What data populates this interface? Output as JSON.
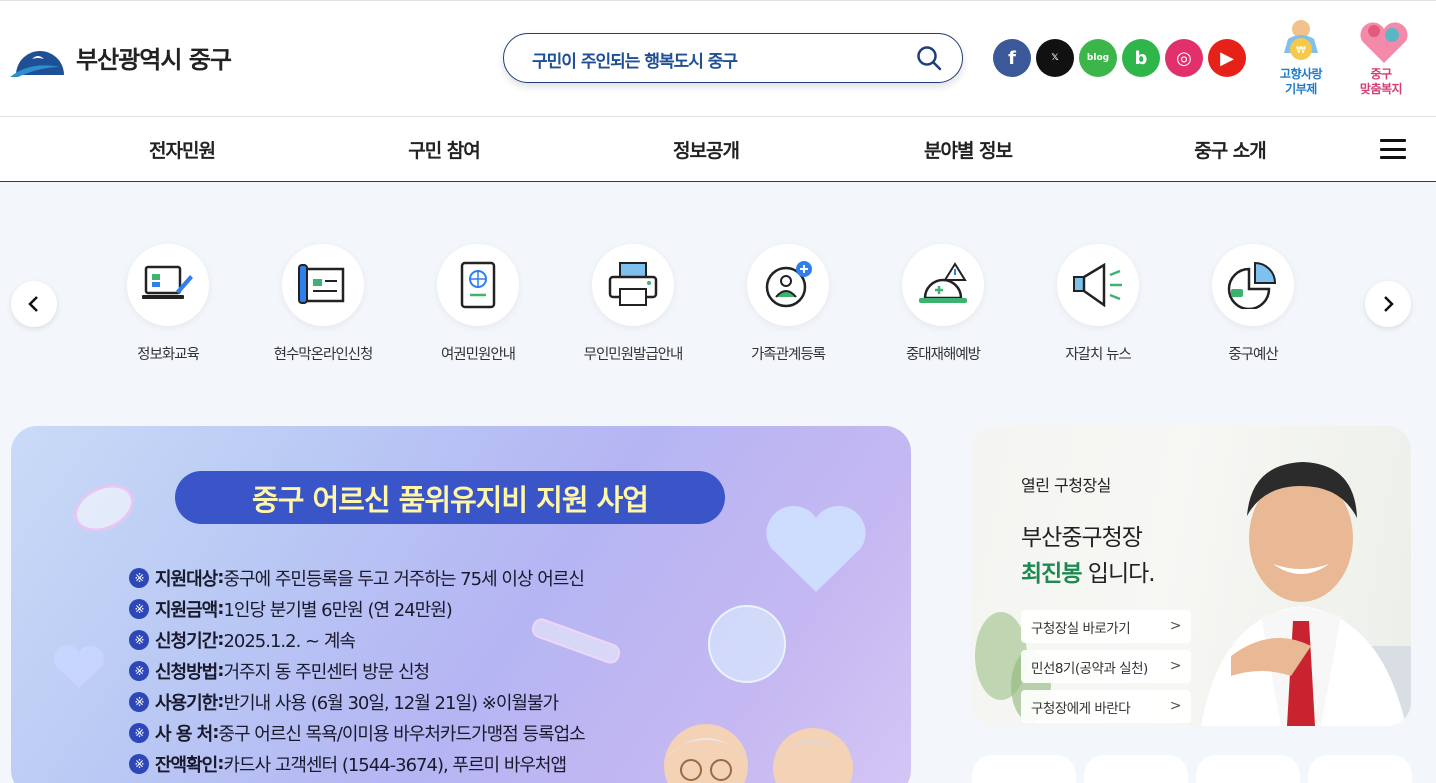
{
  "header": {
    "logo_text": "부산광역시 중구",
    "search_placeholder": "구민이 주인되는 행복도시 중구",
    "sns": [
      {
        "name": "facebook-icon",
        "glyph": "f",
        "color": "#3b5998"
      },
      {
        "name": "x-icon",
        "glyph": "𝕏",
        "color": "#111111"
      },
      {
        "name": "blog-icon",
        "glyph": "blog",
        "color": "#3cb54a"
      },
      {
        "name": "band-icon",
        "glyph": "b",
        "color": "#2fb64b"
      },
      {
        "name": "instagram-icon",
        "glyph": "◎",
        "color": "#e1306c"
      },
      {
        "name": "youtube-icon",
        "glyph": "▶",
        "color": "#e62117"
      }
    ],
    "quick_links": [
      {
        "label_line1": "고향사랑",
        "label_line2": "기부제",
        "color": "#1f7bc7"
      },
      {
        "label_line1": "중구",
        "label_line2": "맞춤복지",
        "color": "#d33b73"
      }
    ]
  },
  "nav": {
    "items": [
      "전자민원",
      "구민 참여",
      "정보공개",
      "분야별 정보",
      "중구 소개"
    ]
  },
  "quick_menu": {
    "items": [
      {
        "label": "정보화교육",
        "icon": "computer-education-icon"
      },
      {
        "label": "현수막온라인신청",
        "icon": "banner-application-icon"
      },
      {
        "label": "여권민원안내",
        "icon": "passport-icon"
      },
      {
        "label": "무인민원발급안내",
        "icon": "printer-icon"
      },
      {
        "label": "가족관계등록",
        "icon": "family-registration-icon"
      },
      {
        "label": "중대재해예방",
        "icon": "safety-helmet-icon"
      },
      {
        "label": "자갈치 뉴스",
        "icon": "megaphone-icon"
      },
      {
        "label": "중구예산",
        "icon": "pie-chart-icon"
      }
    ]
  },
  "banner": {
    "title": "중구 어르신 품위유지비 지원 사업",
    "lines": [
      {
        "key": "지원대상",
        "value": "중구에 주민등록을 두고 거주하는 75세 이상 어르신"
      },
      {
        "key": "지원금액",
        "value": "1인당 분기별 6만원 (연 24만원)"
      },
      {
        "key": "신청기간",
        "value": "2025.1.2. ~ 계속"
      },
      {
        "key": "신청방법",
        "value": "거주지 동 주민센터 방문 신청"
      },
      {
        "key": "사용기한",
        "value": "반기내 사용 (6월 30일, 12월 21일) ※이월불가"
      },
      {
        "key": "사 용 처",
        "value": "중구 어르신 목욕/이미용 바우처카드가맹점 등록업소"
      },
      {
        "key": "잔액확인",
        "value": "카드사 고객센터 (1544-3674), 푸르미 바우처앱"
      }
    ]
  },
  "mayor": {
    "subtitle": "열린 구청장실",
    "title": "부산중구청장",
    "name": "최진봉",
    "name_suffix": " 입니다.",
    "buttons": [
      "구청장실 바로가기",
      "민선8기(공약과 실천)",
      "구청장에게 바란다"
    ]
  }
}
